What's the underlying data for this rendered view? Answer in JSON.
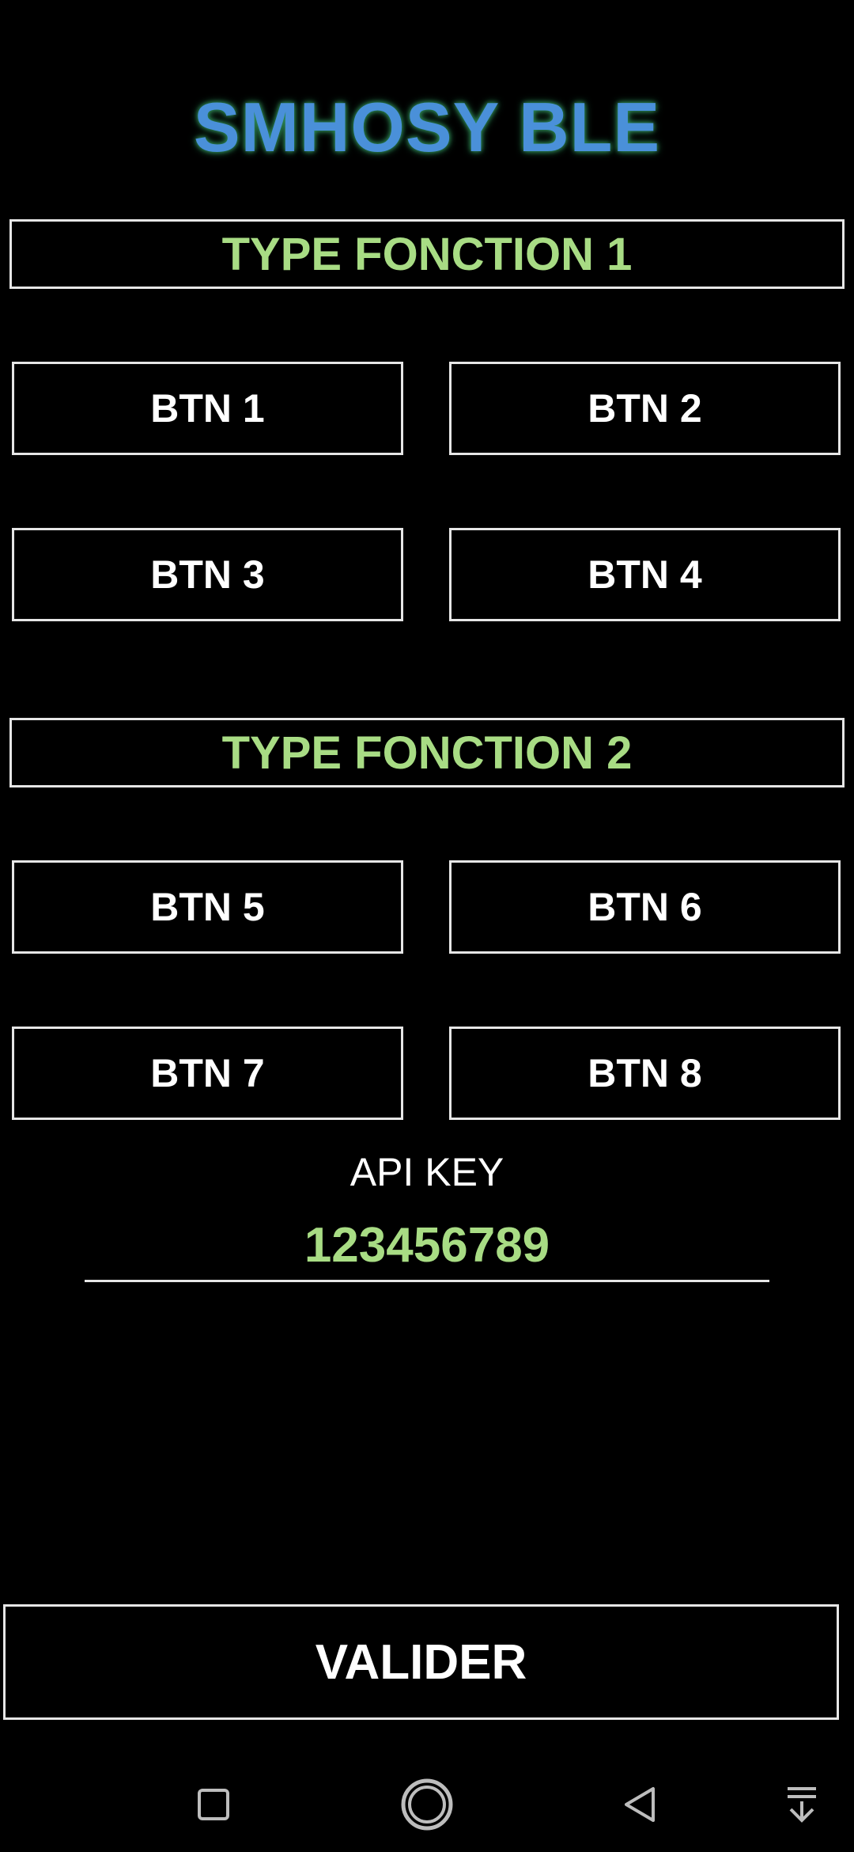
{
  "app": {
    "title": "SMHOSY BLE"
  },
  "section1": {
    "label": "TYPE FONCTION 1"
  },
  "section2": {
    "label": "TYPE FONCTION 2"
  },
  "buttons": [
    {
      "label": "BTN 1"
    },
    {
      "label": "BTN 2"
    },
    {
      "label": "BTN 3"
    },
    {
      "label": "BTN 4"
    },
    {
      "label": "BTN 5"
    },
    {
      "label": "BTN 6"
    },
    {
      "label": "BTN 7"
    },
    {
      "label": "BTN 8"
    }
  ],
  "api": {
    "label": "API KEY",
    "value": "123456789"
  },
  "validate": {
    "label": "VALIDER"
  },
  "colors": {
    "title": "#4a90d9",
    "title_glow": "#2e8b57",
    "section_text": "#a8dc84",
    "border": "#e6e6e6",
    "background": "#000000"
  },
  "navbar": {
    "icons": [
      "recent-apps-icon",
      "home-icon",
      "back-icon",
      "notification-pull-icon"
    ]
  }
}
